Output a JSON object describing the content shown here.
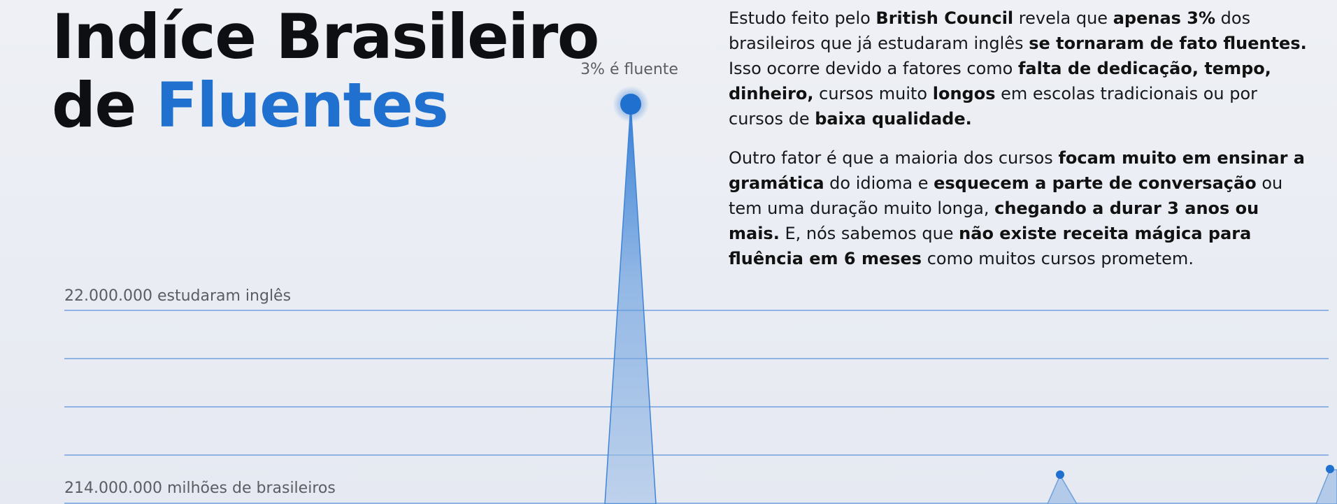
{
  "headline": {
    "line1": "Indíce Brasileiro",
    "line2_prefix": "de ",
    "line2_accent": "Fluentes"
  },
  "article": {
    "paragraph1": [
      {
        "text": "Estudo feito pelo ",
        "bold": false
      },
      {
        "text": "British Council",
        "bold": true
      },
      {
        "text": " revela que ",
        "bold": false
      },
      {
        "text": "apenas 3%",
        "bold": true
      },
      {
        "text": " dos brasileiros que já estudaram inglês ",
        "bold": false
      },
      {
        "text": "se tornaram de fato fluentes.",
        "bold": true
      },
      {
        "text": " Isso ocorre devido a fatores como ",
        "bold": false
      },
      {
        "text": "falta de dedicação, tempo, dinheiro,",
        "bold": true
      },
      {
        "text": " cursos muito ",
        "bold": false
      },
      {
        "text": "longos",
        "bold": true
      },
      {
        "text": " em escolas tradicionais ou por cursos de ",
        "bold": false
      },
      {
        "text": "baixa qualidade.",
        "bold": true
      }
    ],
    "paragraph2": [
      {
        "text": "Outro fator é que a maioria dos cursos ",
        "bold": false
      },
      {
        "text": "focam muito em ensinar a gramática",
        "bold": true
      },
      {
        "text": " do idioma e ",
        "bold": false
      },
      {
        "text": "esquecem a parte de conversação",
        "bold": true
      },
      {
        "text": " ou tem uma duração muito longa, ",
        "bold": false
      },
      {
        "text": "chegando a durar 3 anos ou mais.",
        "bold": true
      },
      {
        "text": " E, nós sabemos que ",
        "bold": false
      },
      {
        "text": "não existe receita mágica para fluência em 6 meses",
        "bold": true
      },
      {
        "text": " como muitos cursos prometem.",
        "bold": false
      }
    ]
  },
  "chart": {
    "peak_label": "3% é fluente",
    "upper_line_label": "22.000.000 estudaram inglês",
    "base_line_label": "214.000.000 milhões de brasileiros",
    "accent_color": "#1f70cf",
    "fill_color": "#b3cbe8",
    "grid_color": "#8fb3e2"
  },
  "chart_data": {
    "type": "area",
    "title": "",
    "xlabel": "",
    "ylabel": "",
    "grid": true,
    "annotations": [
      "3% é fluente",
      "22.000.000 estudaram inglês",
      "214.000.000 milhões de brasileiros"
    ],
    "series": [
      {
        "values": [
          0,
          0,
          100,
          0,
          0,
          12,
          0,
          15
        ]
      }
    ]
  }
}
